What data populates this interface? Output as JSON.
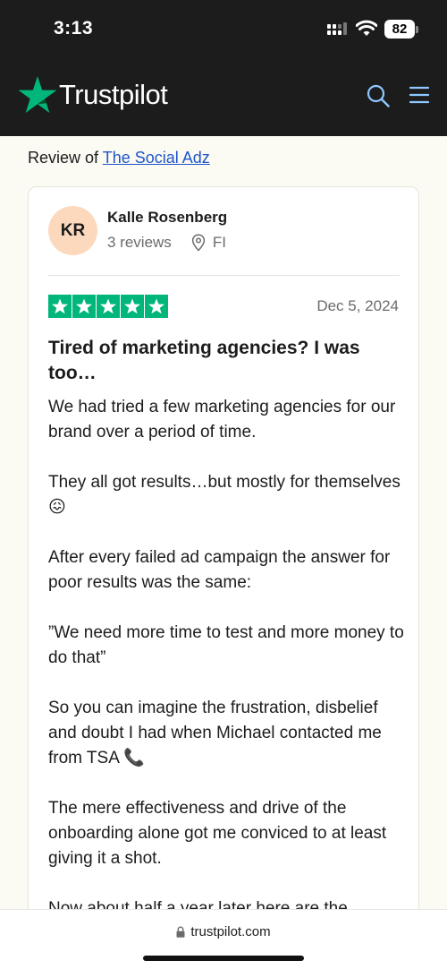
{
  "status_bar": {
    "time": "3:13",
    "battery": "82"
  },
  "header": {
    "brand": "Trustpilot",
    "brand_color": "#00b67a"
  },
  "review_of": {
    "prefix": "Review of",
    "company": "The Social Adz"
  },
  "review": {
    "avatar_initials": "KR",
    "author": "Kalle Rosenberg",
    "reviews_count": "3 reviews",
    "country": "FI",
    "rating": 5,
    "date": "Dec 5, 2024",
    "title": "Tired of marketing agencies? I was too…",
    "paragraphs": [
      "We had tried a few marketing agencies for our brand over a period of time.",
      "They all got results…but mostly for themselves 😖",
      "After every failed ad campaign the answer for poor results was the same:",
      "”We need more time to test and more money to do that”",
      "So you can imagine the frustration, disbelief and doubt I had when Michael contacted me from TSA 📞",
      "The mere effectiveness and drive of the onboarding alone got me conviced to at least giving it a shot.",
      "Now about half a year later here are the"
    ]
  },
  "browser": {
    "url": "trustpilot.com"
  }
}
